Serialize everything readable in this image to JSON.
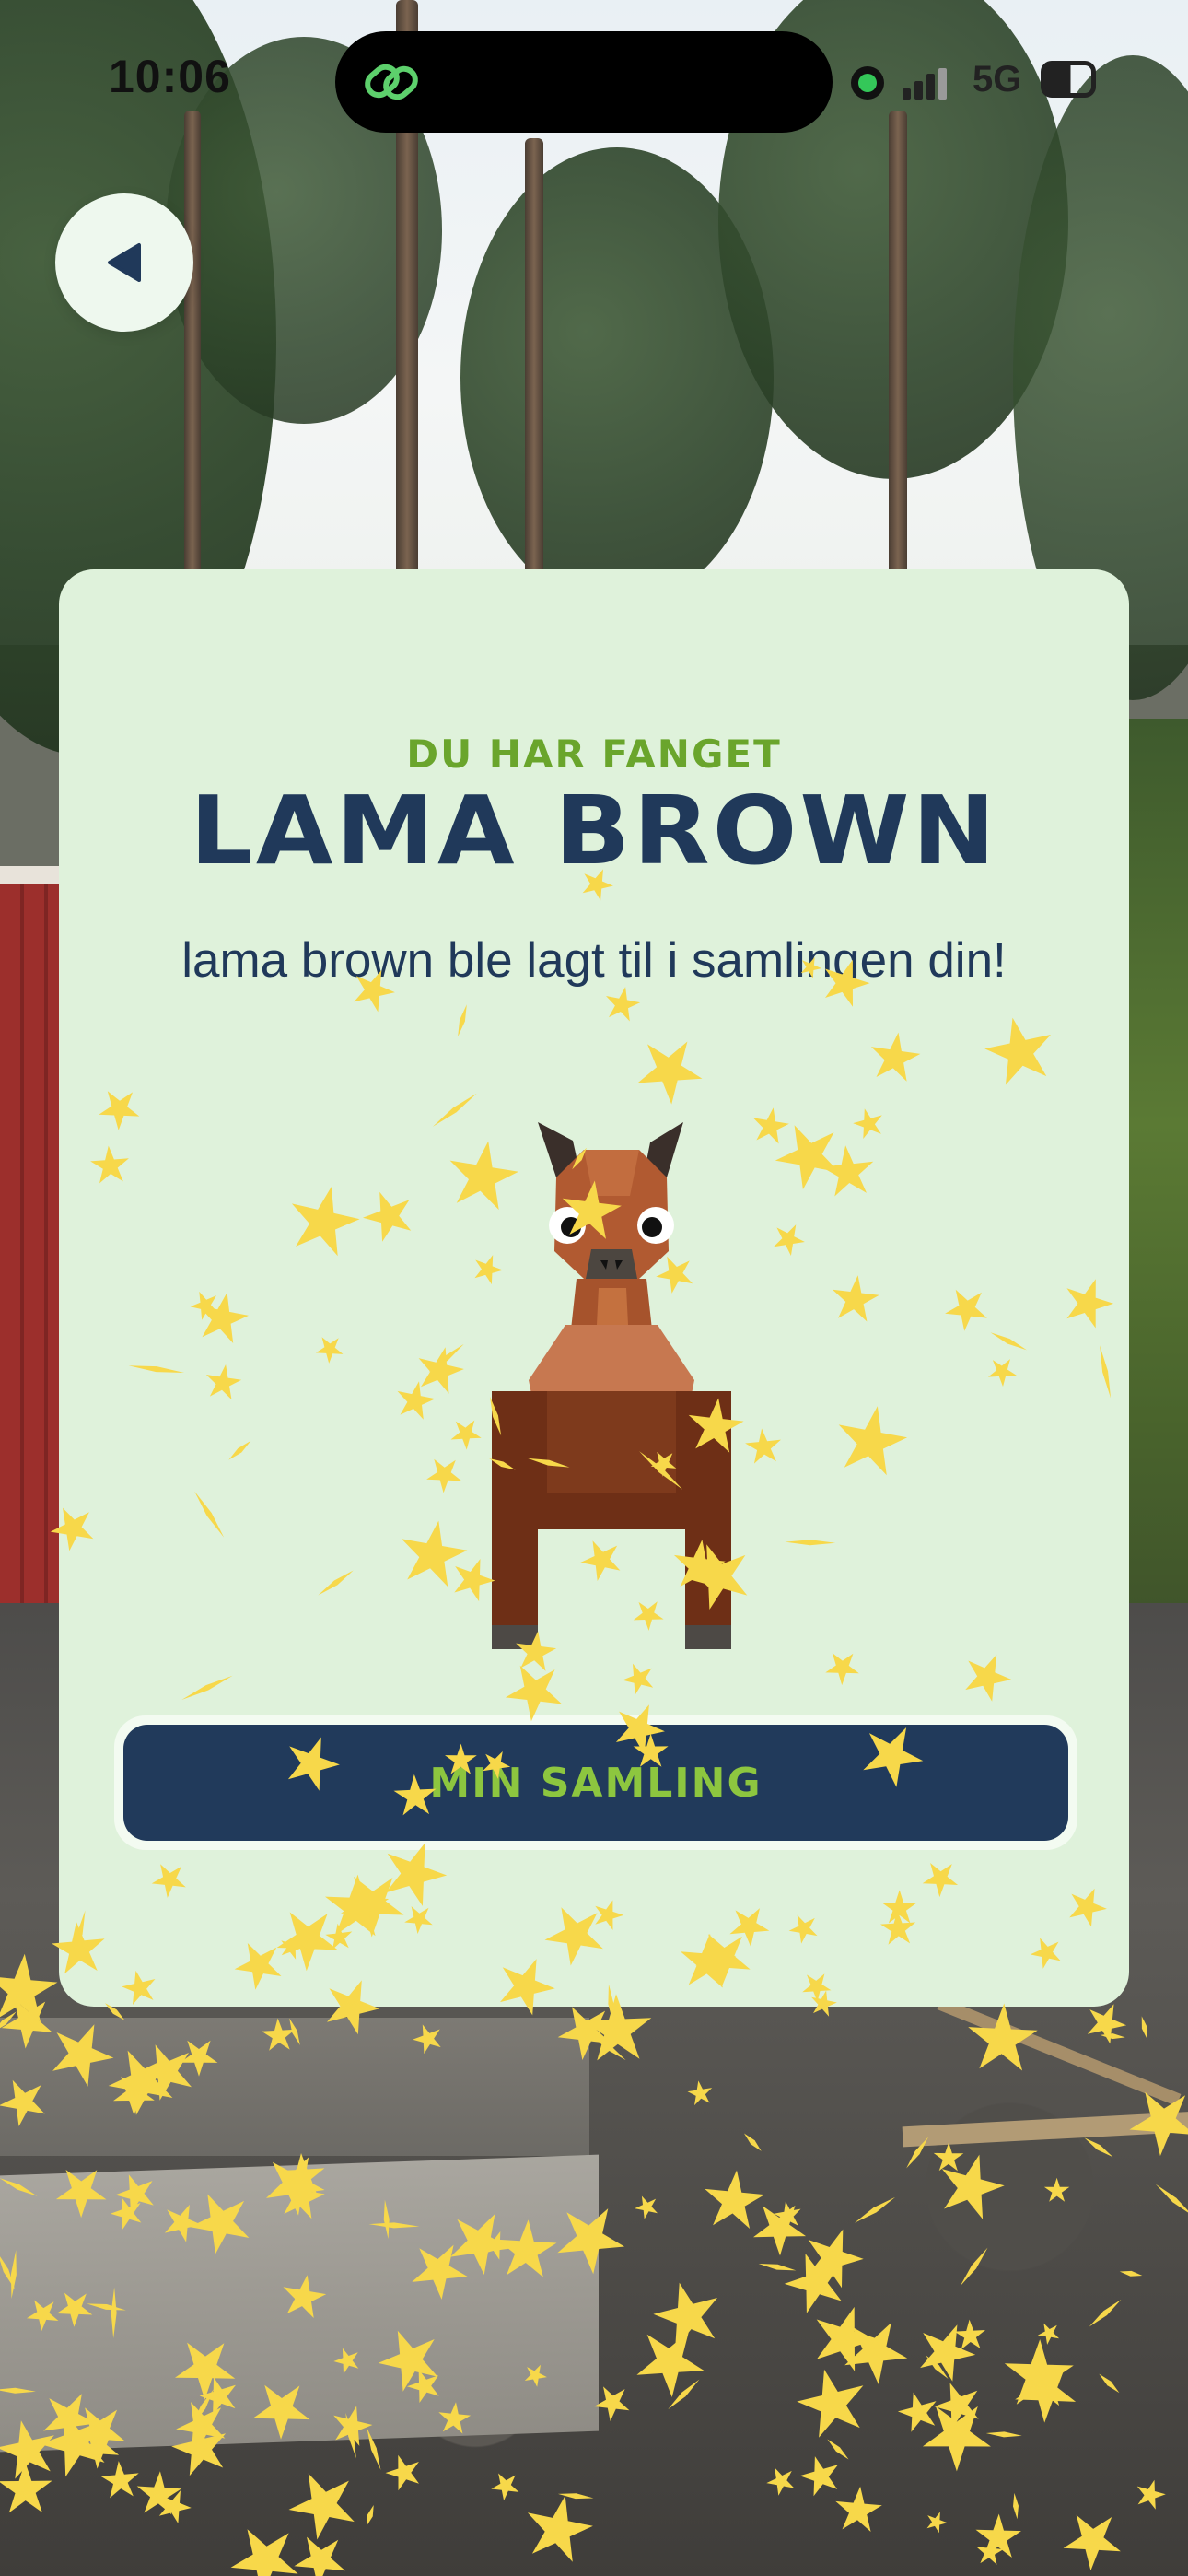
{
  "status_bar": {
    "time": "10:06",
    "network": "5G"
  },
  "header": {
    "back_icon": "back-arrow-icon"
  },
  "card": {
    "eyebrow": "DU HAR FANGET",
    "title": "LAMA BROWN",
    "subtitle": "lama brown ble lagt til i samlingen din!",
    "creature_icon": "llama-brown-icon",
    "button_label": "MIN SAMLING"
  },
  "colors": {
    "card_bg": "#dff2db",
    "title": "#20395a",
    "accent_green": "#6aa52c",
    "button_bg": "#213a5b",
    "button_text": "#8dc63f",
    "sparkle": "#f7d84a"
  }
}
